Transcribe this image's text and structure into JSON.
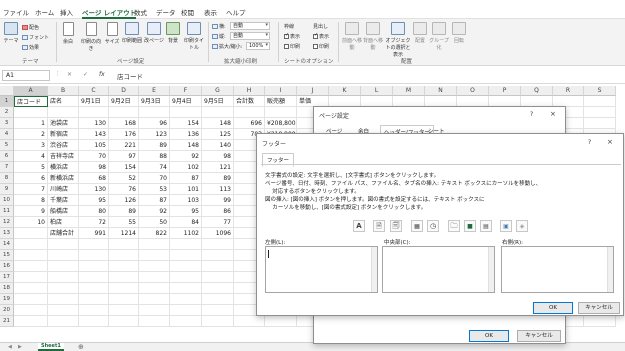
{
  "menu": [
    "ファイル",
    "ホーム",
    "挿入",
    "ページ レイアウト",
    "数式",
    "データ",
    "校閲",
    "表示",
    "ヘルプ"
  ],
  "ribbon": {
    "theme": {
      "main": "テーマ",
      "colors": "配色",
      "fonts": "フォント",
      "effects": "効果",
      "group": "テーマ"
    },
    "page_setup": {
      "margins": "余白",
      "orientation": "印刷の向き",
      "size": "サイズ",
      "print_area": "印刷範囲",
      "breaks": "改ページ",
      "background": "背景",
      "print_titles": "印刷タイトル",
      "group": "ページ設定"
    },
    "scale": {
      "width_label": "横:",
      "width_val": "自動",
      "height_label": "縦:",
      "height_val": "自動",
      "scale_label": "拡大/縮小:",
      "scale_val": "100%",
      "group": "拡大縮小印刷"
    },
    "sheet_options": {
      "gridlines": "枠線",
      "headings": "見出し",
      "view": "表示",
      "print": "印刷",
      "group": "シートのオプション"
    },
    "arrange": {
      "forward": "前面へ移動",
      "backward": "背面へ移動",
      "pane": "オブジェクトの選択と表示",
      "align": "配置",
      "group_btn": "グループ化",
      "rotate": "回転",
      "group": "配置"
    }
  },
  "formula_bar": {
    "cell_ref": "A1",
    "cancel": "×",
    "confirm": "✓",
    "fx": "fx",
    "content": "店コード"
  },
  "columns": [
    "A",
    "B",
    "C",
    "D",
    "E",
    "F",
    "G",
    "H",
    "I",
    "J",
    "K",
    "L",
    "M",
    "N",
    "O",
    "P",
    "Q",
    "R",
    "S"
  ],
  "rows": [
    "1",
    "2",
    "3",
    "4",
    "5",
    "6",
    "7",
    "8",
    "9",
    "10",
    "11",
    "12",
    "13",
    "14",
    "15",
    "16",
    "17",
    "18",
    "19",
    "20",
    "21"
  ],
  "table": {
    "header": [
      "店コード",
      "店名",
      "9月1日",
      "9月2日",
      "9月3日",
      "9月4日",
      "9月5日",
      "合計数",
      "販売額",
      "単価"
    ],
    "rows": [
      [
        "1",
        "池袋店",
        "130",
        "168",
        "96",
        "154",
        "148",
        "696",
        "¥208,800"
      ],
      [
        "2",
        "新宿店",
        "143",
        "176",
        "123",
        "136",
        "125",
        "703",
        "¥210,900"
      ],
      [
        "3",
        "渋谷店",
        "105",
        "221",
        "89",
        "148",
        "140"
      ],
      [
        "4",
        "吉祥寺店",
        "70",
        "97",
        "88",
        "92",
        "98"
      ],
      [
        "5",
        "横浜店",
        "98",
        "154",
        "74",
        "102",
        "121"
      ],
      [
        "6",
        "新横浜店",
        "68",
        "52",
        "70",
        "87",
        "89"
      ],
      [
        "7",
        "川崎店",
        "130",
        "76",
        "53",
        "101",
        "113"
      ],
      [
        "8",
        "千葉店",
        "95",
        "126",
        "87",
        "103",
        "99"
      ],
      [
        "9",
        "船橋店",
        "80",
        "89",
        "92",
        "95",
        "86"
      ],
      [
        "10",
        "柏店",
        "72",
        "55",
        "50",
        "84",
        "77"
      ],
      [
        "",
        "店舗合計",
        "991",
        "1214",
        "822",
        "1102",
        "1096",
        "5"
      ]
    ]
  },
  "sheet_tab": "Sheet1",
  "page_setup_dialog": {
    "title": "ページ設定",
    "help": "?",
    "close": "×",
    "tabs": [
      "ページ",
      "余白",
      "ヘッダー/フッター",
      "シート"
    ],
    "ok": "OK",
    "cancel": "キャンセル"
  },
  "footer_dialog": {
    "title": "フッター",
    "help": "?",
    "close": "×",
    "tab": "フッター",
    "instructions": [
      "文字書式の設定: 文字を選択し、[文字書式] ボタンをクリックします。",
      "ページ番号、日付、時刻、ファイル パス、ファイル名、タブ名の挿入: テキスト ボックスにカーソルを移動し、",
      "　 対応するボタンをクリックします。",
      "図の挿入: [図の挿入] ボタンを押します。図の書式を設定するには、テキスト ボックスに",
      "　 カーソルを移動し、[図の書式設定] ボタンをクリックします。"
    ],
    "left_label": "左側(L):",
    "center_label": "中央部(C):",
    "right_label": "右側(R):",
    "ok": "OK",
    "cancel": "キャンセル",
    "toolbar_icons": [
      "format-text-icon",
      "page-number-icon",
      "page-count-icon",
      "date-icon",
      "time-icon",
      "file-path-icon",
      "file-name-icon",
      "sheet-name-icon",
      "insert-picture-icon",
      "format-picture-icon"
    ]
  },
  "colors": {
    "accent": "#1e6c3d",
    "selected_header": "#d2d2d2"
  }
}
